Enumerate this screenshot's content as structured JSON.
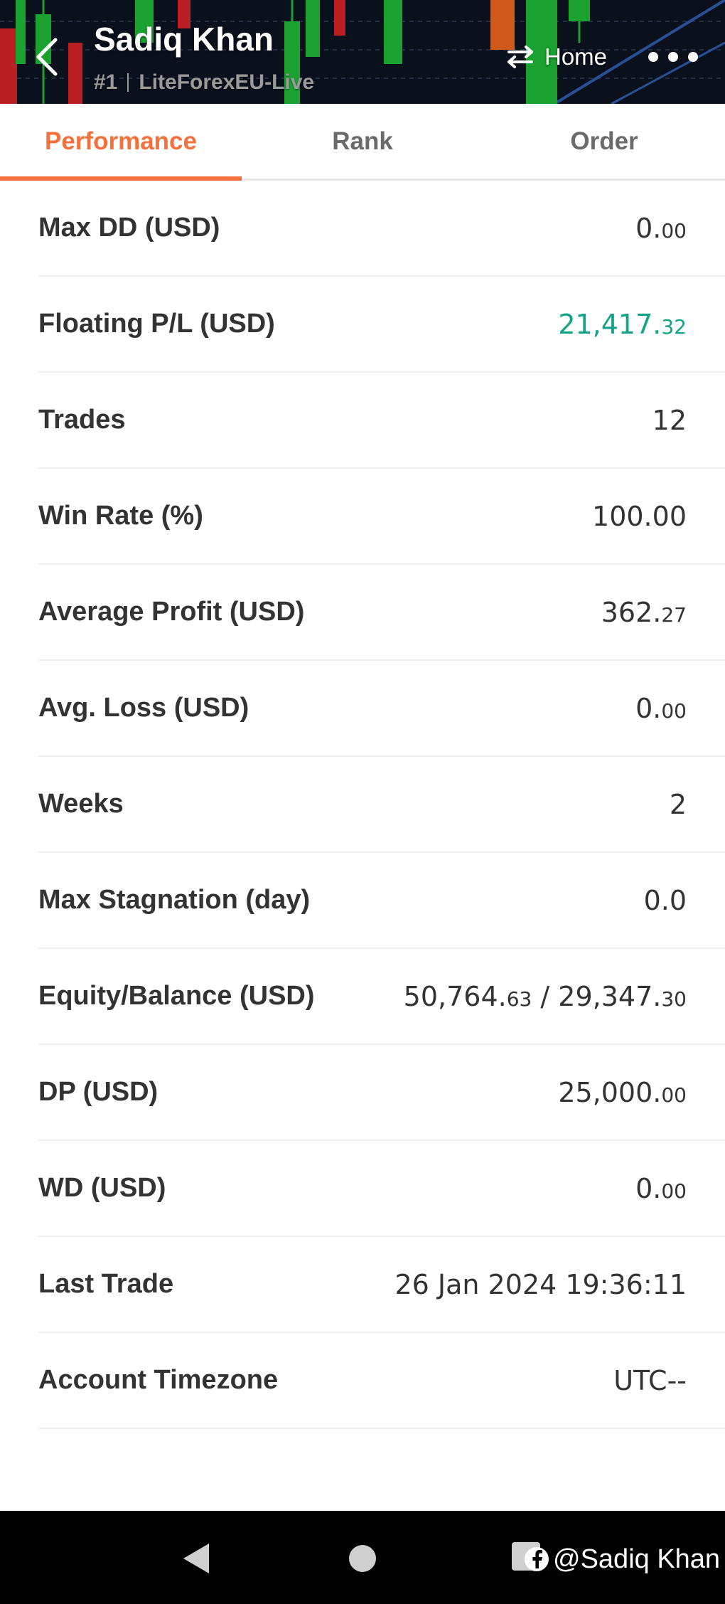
{
  "header": {
    "title": "Sadiq Khan",
    "rank": "#1",
    "server": "LiteForexEU-Live",
    "home_label": "Home"
  },
  "tabs": [
    {
      "label": "Performance",
      "active": true
    },
    {
      "label": "Rank",
      "active": false
    },
    {
      "label": "Order",
      "active": false
    }
  ],
  "stats": [
    {
      "label": "Max DD (USD)",
      "value_main": "0.",
      "value_small": "00"
    },
    {
      "label": "Floating P/L (USD)",
      "value_main": "21,417.",
      "value_small": "32"
    },
    {
      "label": "Trades",
      "value_main": "12"
    },
    {
      "label": "Win Rate (%)",
      "value_main": "100.00"
    },
    {
      "label": "Average Profit (USD)",
      "value_main": "362.",
      "value_small": "27"
    },
    {
      "label": "Avg. Loss (USD)",
      "value_main": "0.",
      "value_small": "00"
    },
    {
      "label": "Weeks",
      "value_main": "2"
    },
    {
      "label": "Max Stagnation (day)",
      "value_main": "0.0"
    },
    {
      "label": "Equity/Balance (USD)",
      "value_main": "50,764.",
      "value_small": "63",
      "value_main2": " / 29,347.",
      "value_small2": "30"
    },
    {
      "label": "DP (USD)",
      "value_main": "25,000.",
      "value_small": "00"
    },
    {
      "label": "WD (USD)",
      "value_main": "0.",
      "value_small": "00"
    },
    {
      "label": "Last Trade",
      "value_main": "26 Jan 2024 19:36:11"
    },
    {
      "label": "Account Timezone",
      "value_main": "UTC--"
    }
  ],
  "watermark": {
    "text": "@Sadiq Khan",
    "icon": "facebook-icon"
  },
  "colors": {
    "accent": "#f5703b",
    "positive": "#13a388",
    "text": "#333333",
    "tab_inactive": "#6b6b6b",
    "divider": "#efefef"
  },
  "icons": {
    "back": "chevron-left-icon",
    "home": "swap-arrows-icon",
    "more": "more-dots-icon"
  }
}
